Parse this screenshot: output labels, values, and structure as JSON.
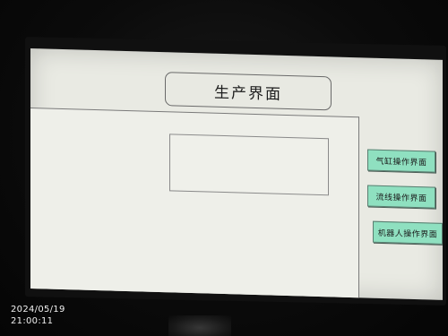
{
  "hmi": {
    "title": "生产界面",
    "buttons": [
      {
        "label": "气缸操作界面"
      },
      {
        "label": "流线操作界面"
      },
      {
        "label": "机器人操作界面"
      }
    ],
    "accent_color": "#8fe0c0"
  },
  "photo_stamp": {
    "date": "2024/05/19",
    "time": "21:00:11"
  }
}
